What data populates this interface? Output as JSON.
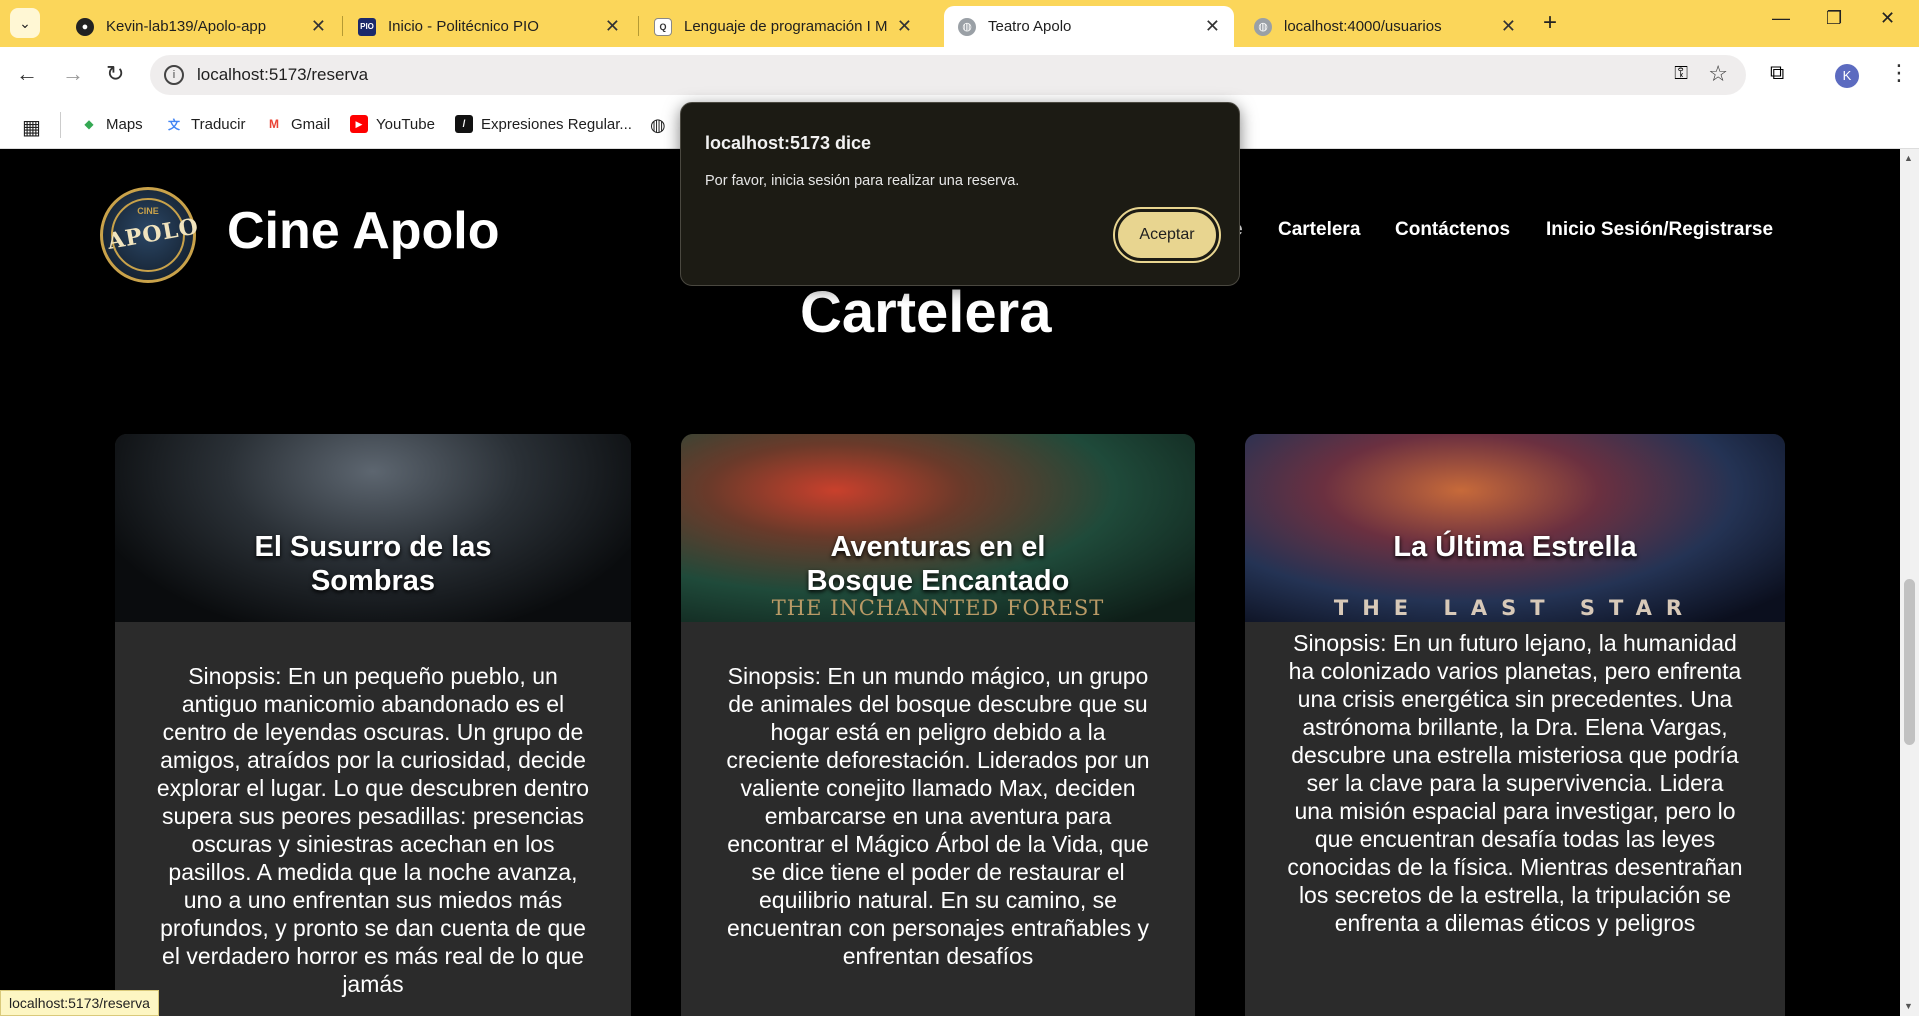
{
  "browser": {
    "tabs": [
      {
        "title": "Kevin-lab139/Apolo-app",
        "favicon": "github-icon"
      },
      {
        "title": "Inicio - Politécnico PIO",
        "favicon": "pio-icon"
      },
      {
        "title": "Lenguaje de programación I M",
        "favicon": "course-icon"
      },
      {
        "title": "Teatro Apolo",
        "favicon": "globe-icon"
      },
      {
        "title": "localhost:4000/usuarios",
        "favicon": "globe-icon"
      }
    ],
    "active_tab": 3,
    "url": "localhost:5173/reserva",
    "profile_initial": "K",
    "bookmarks": [
      "Maps",
      "Traducir",
      "Gmail",
      "YouTube",
      "Expresiones Regular..."
    ],
    "status_url": "localhost:5173/reserva"
  },
  "site": {
    "brand": "Cine Apolo",
    "logo_text": "APOLO",
    "logo_small": "CINE",
    "nav": [
      "e",
      "Cartelera",
      "Contáctenos",
      "Inicio Sesión/Registrarse"
    ],
    "section_title": "Cartelera"
  },
  "movies": [
    {
      "title_line1": "El Susurro de las",
      "title_line2": "Sombras",
      "poster_sub": "",
      "synopsis": "Sinopsis: En un pequeño pueblo, un antiguo manicomio abandonado es el centro de leyendas oscuras. Un grupo de amigos, atraídos por la curiosidad, decide explorar el lugar. Lo que descubren dentro supera sus peores pesadillas: presencias oscuras y siniestras acechan en los pasillos. A medida que la noche avanza, uno a uno enfrentan sus miedos más profundos, y pronto se dan cuenta de que el verdadero horror es más real de lo que jamás"
    },
    {
      "title_line1": "Aventuras en el",
      "title_line2": "Bosque Encantado",
      "poster_sub": "THE INCHANNTED FOREST",
      "synopsis": "Sinopsis: En un mundo mágico, un grupo de animales del bosque descubre que su hogar está en peligro debido a la creciente deforestación. Liderados por un valiente conejito llamado Max, deciden embarcarse en una aventura para encontrar el Mágico Árbol de la Vida, que se dice tiene el poder de restaurar el equilibrio natural. En su camino, se encuentran con personajes entrañables y enfrentan desafíos"
    },
    {
      "title_line1": "La Última Estrella",
      "title_line2": "",
      "poster_sub": "THE LAST STAR",
      "synopsis": "Sinopsis: En un futuro lejano, la humanidad ha colonizado varios planetas, pero enfrenta una crisis energética sin precedentes. Una astrónoma brillante, la Dra. Elena Vargas, descubre una estrella misteriosa que podría ser la clave para la supervivencia. Lidera una misión espacial para investigar, pero lo que encuentran desafía todas las leyes conocidas de la física. Mientras desentrañan los secretos de la estrella, la tripulación se enfrenta a dilemas éticos y peligros"
    }
  ],
  "dialog": {
    "title": "localhost:5173 dice",
    "message": "Por favor, inicia sesión para realizar una reserva.",
    "button": "Aceptar"
  }
}
